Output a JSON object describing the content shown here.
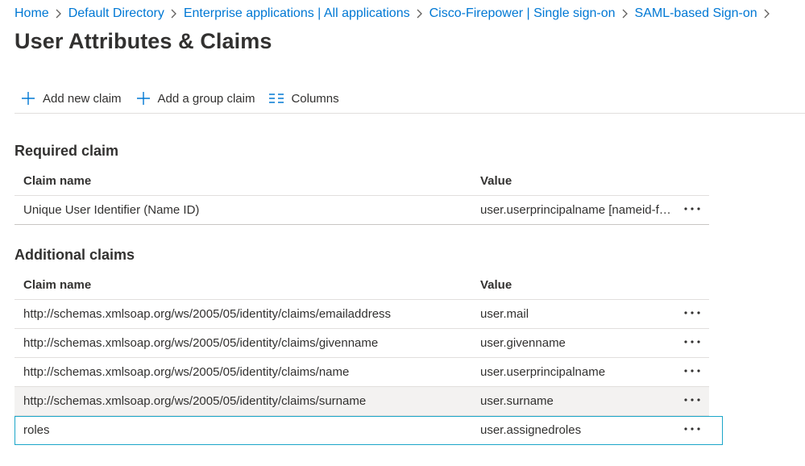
{
  "breadcrumb": [
    {
      "label": "Home"
    },
    {
      "label": "Default Directory"
    },
    {
      "label": "Enterprise applications | All applications"
    },
    {
      "label": "Cisco-Firepower | Single sign-on"
    },
    {
      "label": "SAML-based Sign-on"
    }
  ],
  "page_title": "User Attributes & Claims",
  "toolbar": {
    "add_claim_label": "Add new claim",
    "add_group_claim_label": "Add a group claim",
    "columns_label": "Columns"
  },
  "colors": {
    "accent": "#0078d4",
    "selected_outline": "#1ba6c9"
  },
  "required": {
    "title": "Required claim",
    "header": {
      "name": "Claim name",
      "value": "Value"
    },
    "rows": [
      {
        "name": "Unique User Identifier (Name ID)",
        "value": "user.userprincipalname [nameid-for..."
      }
    ]
  },
  "additional": {
    "title": "Additional claims",
    "header": {
      "name": "Claim name",
      "value": "Value"
    },
    "rows": [
      {
        "name": "http://schemas.xmlsoap.org/ws/2005/05/identity/claims/emailaddress",
        "value": "user.mail"
      },
      {
        "name": "http://schemas.xmlsoap.org/ws/2005/05/identity/claims/givenname",
        "value": "user.givenname"
      },
      {
        "name": "http://schemas.xmlsoap.org/ws/2005/05/identity/claims/name",
        "value": "user.userprincipalname"
      },
      {
        "name": "http://schemas.xmlsoap.org/ws/2005/05/identity/claims/surname",
        "value": "user.surname"
      },
      {
        "name": "roles",
        "value": "user.assignedroles"
      }
    ]
  }
}
